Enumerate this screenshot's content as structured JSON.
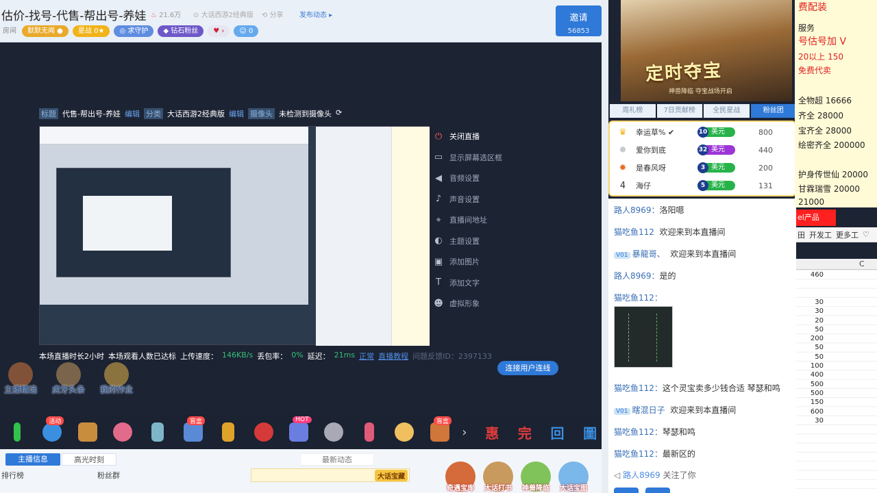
{
  "header": {
    "room_title": "估价-找号-代售-帮出号-养娃",
    "heat": "21.6万",
    "category": "大话西游2经典版",
    "share": "分享",
    "gift_link": "发布动态",
    "badges": [
      "房间",
      "默默无闻",
      "星战",
      "求守护",
      "钻石粉丝",
      "",
      ""
    ],
    "badge_star_level": "0",
    "badge_guard_count": "0",
    "invite_label": "邀请",
    "invite_count": "56853"
  },
  "player": {
    "info_labels": {
      "title_tag": "标题",
      "title": "代售-帮出号-养娃",
      "edit": "编辑",
      "category_tag": "分类",
      "category": "大话西游2经典版",
      "camera_tag": "摄像头",
      "camera_status": "未检测到摄像头"
    },
    "menu": [
      {
        "icon": "power-icon",
        "label": "关闭直播"
      },
      {
        "icon": "monitor-icon",
        "label": "显示屏幕选区框"
      },
      {
        "icon": "speaker-icon",
        "label": "音频设置"
      },
      {
        "icon": "mic-icon",
        "label": "声音设置"
      },
      {
        "icon": "location-icon",
        "label": "直播间地址"
      },
      {
        "icon": "palette-icon",
        "label": "主题设置"
      },
      {
        "icon": "image-icon",
        "label": "添加图片"
      },
      {
        "icon": "text-icon",
        "label": "添加文字"
      },
      {
        "icon": "person-icon",
        "label": "虚拟形象"
      }
    ],
    "stats": {
      "duration": "本场直播时长2小时",
      "viewers": "本场观看人数已达标",
      "upload_label": "上传速度：",
      "upload_value": "146KB/s",
      "loss_label": "丢包率：",
      "loss_value": "0%",
      "delay_label": "延迟：",
      "delay_value": "21ms",
      "normal": "正常",
      "tutorial": "直播教程",
      "id_text": "问题反馈ID：2397133"
    },
    "tools": [
      "主播精选",
      "虎牙头条",
      "我的作业"
    ],
    "fake_user_button": "连接用户连线"
  },
  "gifts": {
    "tags": [
      "活动",
      "盲盒",
      "HOT",
      "盲盒"
    ],
    "icons": [
      "惠",
      "完",
      "回",
      "圖"
    ]
  },
  "bottom": {
    "tab_host": "主播信息",
    "tab_highlight": "高光时刻",
    "tab_news": "最新动态",
    "rank_label": "排行榜",
    "fans_label": "粉丝群",
    "promo_tag": "大话宝藏",
    "features": [
      "奇遇宝库",
      "大话打书",
      "神兽降临",
      "大话宝图"
    ]
  },
  "ad": {
    "title": "定时夺宝",
    "subtitle": "神兽降临 夺宝战场开启"
  },
  "rank_tabs": [
    "周礼榜",
    "7日贡献榜",
    "全民星战",
    "粉丝团"
  ],
  "rank_active": 3,
  "ranking": [
    {
      "pos": "1",
      "name": "幸运草%",
      "level": "10",
      "level_label": "美元",
      "score": "800"
    },
    {
      "pos": "2",
      "name": "爱你到底",
      "level": "32",
      "level_label": "美元",
      "score": "440"
    },
    {
      "pos": "3",
      "name": "是春风呀",
      "level": "3",
      "level_label": "美元",
      "score": "200"
    },
    {
      "pos": "4",
      "name": "海仔",
      "level": "5",
      "level_label": "美元",
      "score": "131"
    }
  ],
  "chat": [
    {
      "user": "路人8969：",
      "text": "洛阳嗯",
      "badge": ""
    },
    {
      "user": "猫吃鱼112",
      "text": "欢迎来到本直播间",
      "badge": ""
    },
    {
      "user": "暴龍哥、",
      "text": "欢迎来到本直播间",
      "badge": "V01"
    },
    {
      "user": "路人8969：",
      "text": "是的",
      "badge": ""
    },
    {
      "user": "猫吃鱼112：",
      "text": "",
      "badge": ""
    },
    {
      "user": "猫吃鱼112：",
      "text": "这个灵宝卖多少钱合适 琴瑟和鸣",
      "badge": ""
    },
    {
      "user": "瞎混日子",
      "text": "欢迎来到本直播间",
      "badge": "V01"
    },
    {
      "user": "猫吃鱼112：",
      "text": "琴瑟和鸣",
      "badge": ""
    },
    {
      "user": "猫吃鱼112：",
      "text": "最新区的",
      "badge": ""
    }
  ],
  "follow": {
    "user": "路人8969",
    "text": "关注了你"
  },
  "sheet": {
    "lines": [
      "费配装",
      "服务",
      "号估号加 V",
      "20以上 150",
      "免费代卖",
      "全物超 16666",
      "齐全 28000",
      "宝齐全 28000",
      "绘密齐全 200000",
      "护身传世仙 20000",
      "甘霖瑞雪 20000",
      "21000"
    ],
    "red_tab": "el产品",
    "toolbar": [
      "开发工",
      "更多工"
    ],
    "col_header": "C",
    "values": [
      "460",
      "",
      "",
      "30",
      "30",
      "20",
      "50",
      "200",
      "50",
      "50",
      "100",
      "400",
      "500",
      "500",
      "150",
      "600",
      "30"
    ]
  },
  "colors": {
    "accent": "#2f79d8",
    "bg_dark": "#1c2333",
    "green": "#37c07a",
    "red": "#ff2020"
  }
}
